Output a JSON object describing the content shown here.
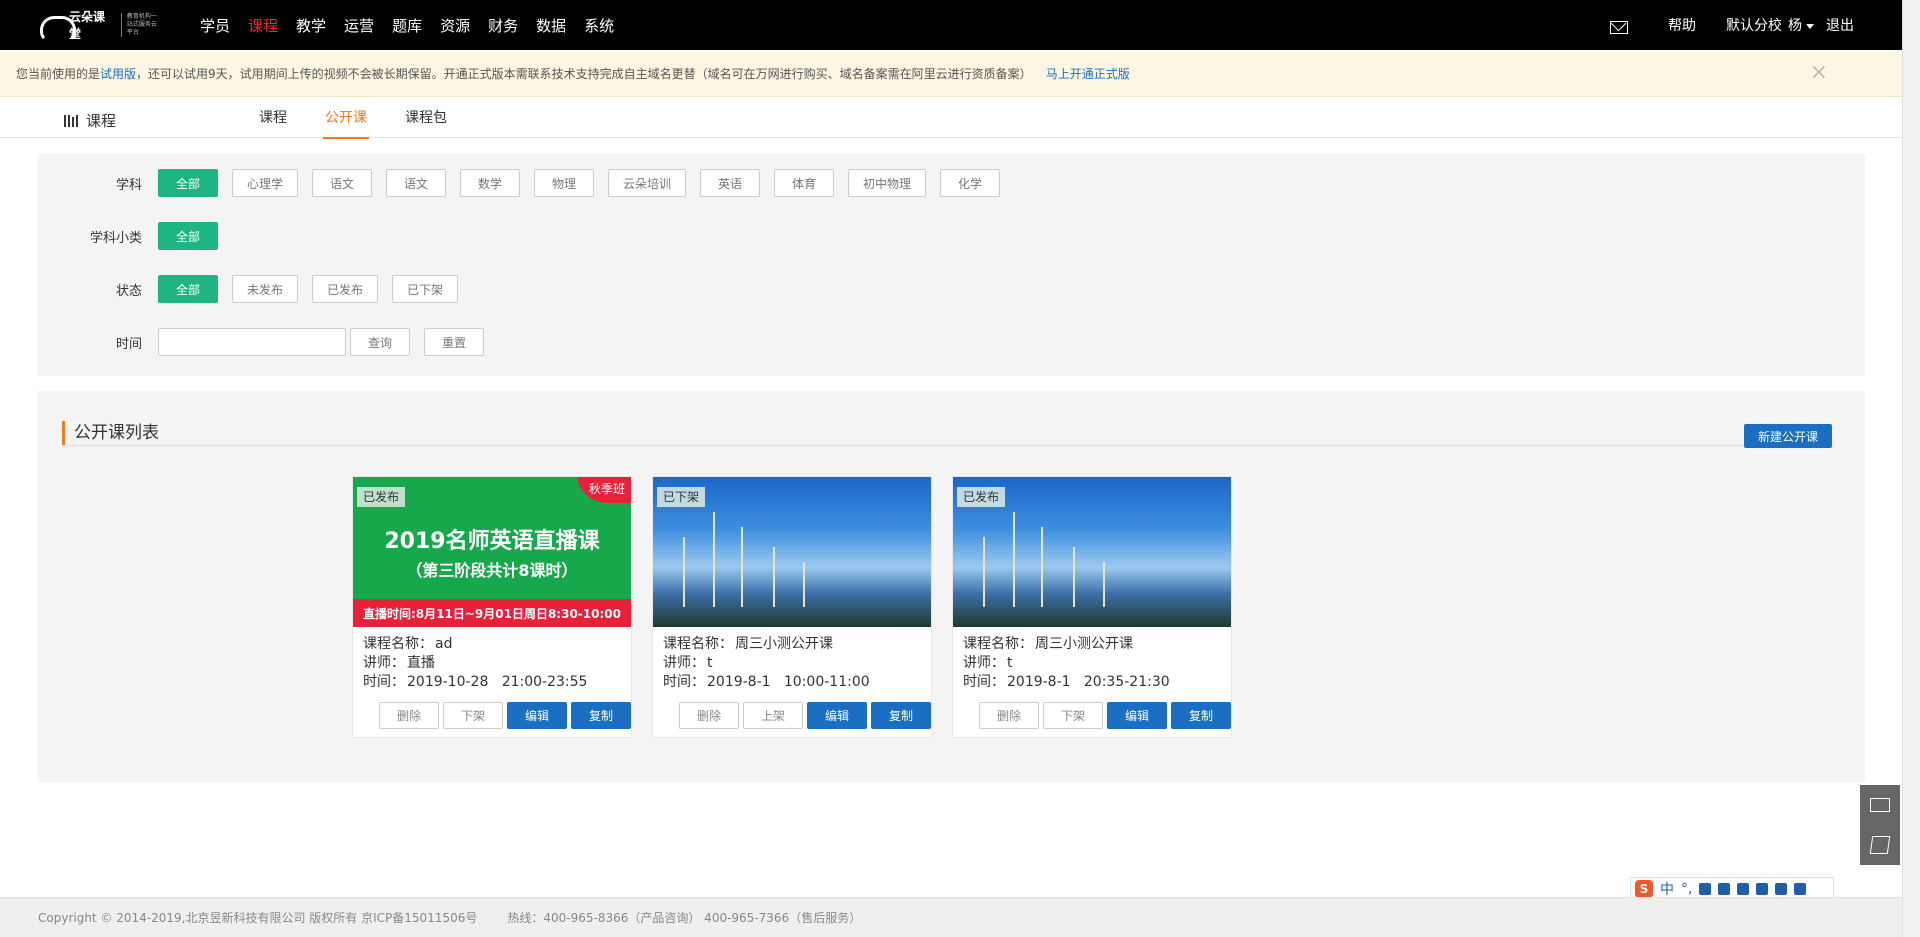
{
  "header": {
    "logo_text": "云朵课堂",
    "logo_sub": "教育机构一站式服务云平台",
    "nav": [
      "学员",
      "课程",
      "教学",
      "运营",
      "题库",
      "资源",
      "财务",
      "数据",
      "系统"
    ],
    "active_nav": "课程",
    "help": "帮助",
    "branch": "默认分校",
    "user": "杨",
    "logout": "退出"
  },
  "notice": {
    "prefix": "您当前使用的是",
    "trial": "试用版",
    "text": "，还可以试用9天，试用期间上传的视频不会被长期保留。开通正式版本需联系技术支持完成自主域名更替（域名可在万网进行购买、域名备案需在阿里云进行资质备案）",
    "link": "马上开通正式版",
    "close": "×"
  },
  "subnav": {
    "title": "课程",
    "tabs": [
      "课程",
      "公开课",
      "课程包"
    ],
    "active_tab": "公开课"
  },
  "filters": {
    "subject": {
      "label": "学科",
      "options": [
        "全部",
        "心理学",
        "语文",
        "语文",
        "数学",
        "物理",
        "云朵培训",
        "英语",
        "体育",
        "初中物理",
        "化学"
      ]
    },
    "subcategory": {
      "label": "学科小类",
      "options": [
        "全部"
      ]
    },
    "status": {
      "label": "状态",
      "options": [
        "全部",
        "未发布",
        "已发布",
        "已下架"
      ]
    },
    "time": {
      "label": "时间",
      "value": "",
      "query": "查询",
      "reset": "重置"
    }
  },
  "list": {
    "title": "公开课列表",
    "new_button": "新建公开课",
    "cards": [
      {
        "status": "已发布",
        "thumb_title": "2019名师英语直播课",
        "thumb_sub": "（第三阶段共计8课时）",
        "thumb_strip": "直播时间:8月11日~9月01日周日8:30-10:00",
        "thumb_tag": "秋季班",
        "name_label": "课程名称：",
        "name": "ad",
        "teacher_label": "讲师：",
        "teacher": "直播",
        "time_label": "时间：",
        "time": "2019-10-28   21:00-23:55",
        "actions": [
          "删除",
          "下架",
          "编辑",
          "复制"
        ]
      },
      {
        "status": "已下架",
        "name_label": "课程名称：",
        "name": "周三小测公开课",
        "teacher_label": "讲师：",
        "teacher": "t",
        "time_label": "时间：",
        "time": "2019-8-1   10:00-11:00",
        "actions": [
          "删除",
          "上架",
          "编辑",
          "复制"
        ]
      },
      {
        "status": "已发布",
        "name_label": "课程名称：",
        "name": "周三小测公开课",
        "teacher_label": "讲师：",
        "teacher": "t",
        "time_label": "时间：",
        "time": "2019-8-1   20:35-21:30",
        "actions": [
          "删除",
          "下架",
          "编辑",
          "复制"
        ]
      }
    ]
  },
  "ime": {
    "lang": "中",
    "punct": "°,"
  },
  "footer": {
    "copyright": "Copyright © 2014-2019,北京昱新科技有限公司 版权所有 京ICP备15011506号",
    "hotline": "热线：400-965-8366（产品咨询） 400-965-7366（售后服务）"
  },
  "colors": {
    "accent": "#1fb580",
    "primary": "#1a6fc2",
    "highlight": "#f07c1e",
    "nav_active": "#e52e2e"
  }
}
